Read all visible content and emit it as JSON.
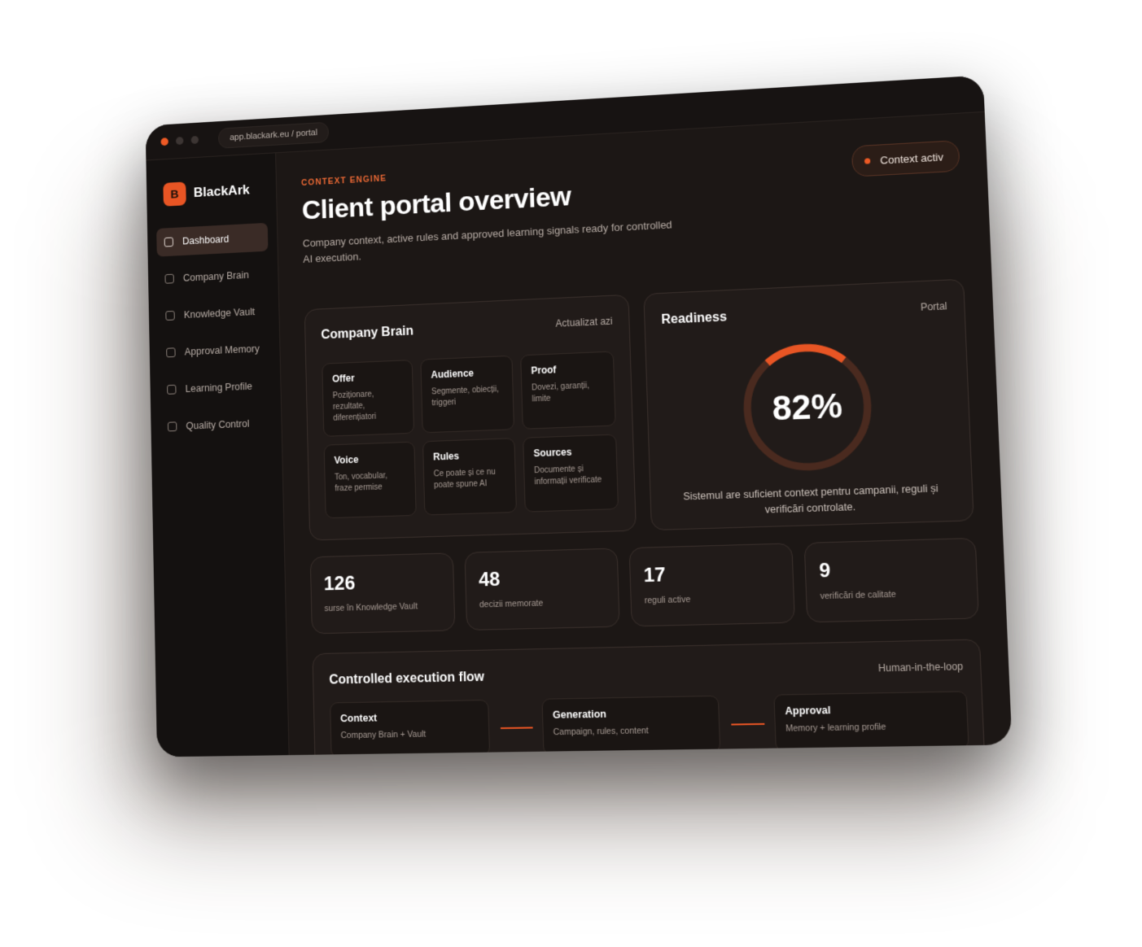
{
  "browser": {
    "url": "app.blackark.eu / portal"
  },
  "brand": {
    "mark": "B",
    "name": "BlackArk"
  },
  "sidebar": {
    "items": [
      {
        "label": "Dashboard",
        "active": true
      },
      {
        "label": "Company Brain",
        "active": false
      },
      {
        "label": "Knowledge Vault",
        "active": false
      },
      {
        "label": "Approval Memory",
        "active": false
      },
      {
        "label": "Learning Profile",
        "active": false
      },
      {
        "label": "Quality Control",
        "active": false
      }
    ]
  },
  "header": {
    "eyebrow": "CONTEXT ENGINE",
    "title": "Client portal overview",
    "subtitle": "Company context, active rules and approved learning signals ready for controlled AI execution.",
    "status_pill": "Context activ"
  },
  "company_brain": {
    "title": "Company Brain",
    "meta": "Actualizat azi",
    "tiles": [
      {
        "title": "Offer",
        "desc": "Poziționare, rezultate, diferențiatori"
      },
      {
        "title": "Audience",
        "desc": "Segmente, obiecții, triggeri"
      },
      {
        "title": "Proof",
        "desc": "Dovezi, garanții, limite"
      },
      {
        "title": "Voice",
        "desc": "Ton, vocabular, fraze permise"
      },
      {
        "title": "Rules",
        "desc": "Ce poate și ce nu poate spune AI"
      },
      {
        "title": "Sources",
        "desc": "Documente și informații verificate"
      }
    ]
  },
  "readiness": {
    "title": "Readiness",
    "meta": "Portal",
    "value_label": "82%",
    "value": 0.82,
    "caption": "Sistemul are suficient context pentru campanii, reguli și verificări controlate."
  },
  "stats": [
    {
      "value": "126",
      "label": "surse în Knowledge Vault"
    },
    {
      "value": "48",
      "label": "decizii memorate"
    },
    {
      "value": "17",
      "label": "reguli active"
    },
    {
      "value": "9",
      "label": "verificări de calitate"
    }
  ],
  "flow": {
    "title": "Controlled execution flow",
    "meta": "Human-in-the-loop",
    "steps": [
      {
        "title": "Context",
        "desc": "Company Brain + Vault"
      },
      {
        "title": "Generation",
        "desc": "Campaign, rules, content"
      },
      {
        "title": "Approval",
        "desc": "Memory + learning profile"
      }
    ]
  },
  "colors": {
    "accent": "#E85524",
    "background": "#1C1715",
    "card": "#211B19"
  }
}
